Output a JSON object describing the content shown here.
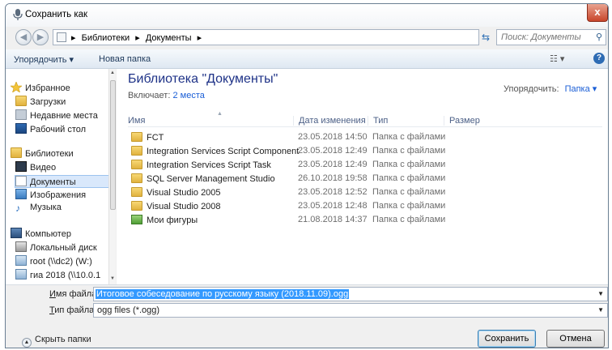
{
  "window": {
    "title": "Сохранить как",
    "close_glyph": "x",
    "icon": "microphone-icon"
  },
  "address": {
    "crumbs": [
      "▸",
      "Библиотеки",
      "▸",
      "Документы",
      "▸"
    ],
    "search_placeholder": "Поиск: Документы"
  },
  "toolbar": {
    "organize_label": "Упорядочить ▾",
    "new_folder_label": "Новая папка",
    "view_glyph": "☷ ▾",
    "help_glyph": "?"
  },
  "nav": {
    "items": [
      {
        "label": "Избранное",
        "icon": "star-icon"
      },
      {
        "label": "Загрузки",
        "icon": "downloads-icon"
      },
      {
        "label": "Недавние места",
        "icon": "recent-places-icon"
      },
      {
        "label": "Рабочий стол",
        "icon": "desktop-icon"
      },
      {
        "label": "Библиотеки",
        "icon": "libraries-icon"
      },
      {
        "label": "Видео",
        "icon": "video-icon"
      },
      {
        "label": "Документы",
        "icon": "documents-icon"
      },
      {
        "label": "Изображения",
        "icon": "images-icon"
      },
      {
        "label": "Музыка",
        "icon": "music-icon"
      },
      {
        "label": "Компьютер",
        "icon": "computer-icon"
      },
      {
        "label": "Локальный диск",
        "icon": "local-disk-icon"
      },
      {
        "label": "root (\\\\dc2) (W:)",
        "icon": "network-drive-icon"
      },
      {
        "label": "гиа 2018 (\\\\10.0.1",
        "icon": "network-drive-icon"
      }
    ]
  },
  "library": {
    "title": "Библиотека \"Документы\"",
    "includes_label": "Включает:",
    "includes_link": "2 места",
    "arrange_label": "Упорядочить:",
    "arrange_value": "Папка ▾"
  },
  "columns": {
    "name": "Имя",
    "date": "Дата изменения",
    "type": "Тип",
    "size": "Размер"
  },
  "files": [
    {
      "name": "FCT",
      "date": "23.05.2018 14:50",
      "type": "Папка с файлами",
      "icon": "folder-icon"
    },
    {
      "name": "Integration Services Script Component",
      "date": "23.05.2018 12:49",
      "type": "Папка с файлами",
      "icon": "folder-icon"
    },
    {
      "name": "Integration Services Script Task",
      "date": "23.05.2018 12:49",
      "type": "Папка с файлами",
      "icon": "folder-icon"
    },
    {
      "name": "SQL Server Management Studio",
      "date": "26.10.2018 19:58",
      "type": "Папка с файлами",
      "icon": "folder-icon"
    },
    {
      "name": "Visual Studio 2005",
      "date": "23.05.2018 12:52",
      "type": "Папка с файлами",
      "icon": "folder-icon"
    },
    {
      "name": "Visual Studio 2008",
      "date": "23.05.2018 12:48",
      "type": "Папка с файлами",
      "icon": "folder-icon"
    },
    {
      "name": "Мои фигуры",
      "date": "21.08.2018 14:37",
      "type": "Папка с файлами",
      "icon": "shapes-folder-icon"
    }
  ],
  "form": {
    "filename_label_u": "И",
    "filename_label_rest": "мя файла:",
    "filename_value": "Итоговое собеседование по русскому языку (2018.11.09).ogg",
    "filetype_label_u": "Т",
    "filetype_label_rest": "ип файла:",
    "filetype_value": "ogg files (*.ogg)"
  },
  "footer": {
    "hide_folders_label": "Скрыть папки",
    "save_label": "Сохранить",
    "cancel_label": "Отмена"
  },
  "colors": {
    "accent": "#1a5ed6",
    "title_blue": "#1e3287",
    "selection": "#3399ff"
  }
}
